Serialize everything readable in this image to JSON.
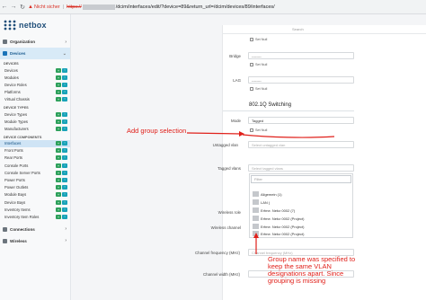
{
  "browser": {
    "warning": "Nicht sicher",
    "protocol": "https://",
    "path": "/dcim/interfaces/edit/?device=89&return_url=/dcim/devices/89/interfaces/"
  },
  "sidebar": {
    "logo": "netbox",
    "organization": "Organization",
    "devices_menu": "Devices",
    "section_devices": "DEVICES",
    "devices_items": [
      "Devices",
      "Modules",
      "Device Roles",
      "Platforms",
      "Virtual Chassis"
    ],
    "section_device_types": "DEVICE TYPES",
    "device_type_items": [
      "Device Types",
      "Module Types",
      "Manufacturers"
    ],
    "section_components": "DEVICE COMPONENTS",
    "component_items": [
      "Interfaces",
      "Front Ports",
      "Rear Ports",
      "Console Ports",
      "Console Server Ports",
      "Power Ports",
      "Power Outlets",
      "Module Bays",
      "Device Bays",
      "Inventory Items",
      "Inventory Item Roles"
    ],
    "connections": "Connections",
    "wireless": "Wireless"
  },
  "form": {
    "search_hint": "Search",
    "set_null": "Set Null",
    "bridge_label": "Bridge",
    "bridge_value": "--------",
    "lag_label": "LAG",
    "lag_value": "--------",
    "section_title": "802.1Q Switching",
    "mode_label": "Mode",
    "mode_value": "Tagged",
    "untagged_label": "Untagged vlan",
    "untagged_placeholder": "Select untagged vlan",
    "tagged_label": "Tagged vlans",
    "tagged_placeholder": "Select tagged vlans",
    "dropdown_search": "Filter",
    "options": [
      "Allgemein (1)",
      "LAN (",
      "Erfme. Nebz 0002 (7)",
      "Erfme. Nebz 0002 (Project)",
      "Erfme. Nebz 0002 (Project)",
      "Erfme. Nebz 0002 (Project)"
    ],
    "wireless_role_label": "Wireless role",
    "wireless_channel_label": "Wireless channel",
    "channel_freq_label": "Channel frequency (MHz)",
    "channel_freq_placeholder": "Channel frequency (MHz)",
    "channel_width_label": "Channel width (MHz)"
  },
  "annotations": {
    "add_group": "Add group selection",
    "note": "Group name was specified to keep the same VLAN designations apart. Since grouping is missing"
  },
  "colors": {
    "annotation": "#e0201a",
    "brand": "#1f4e79",
    "plus_button": "#2ca05a",
    "import_button": "#17a2b8"
  }
}
